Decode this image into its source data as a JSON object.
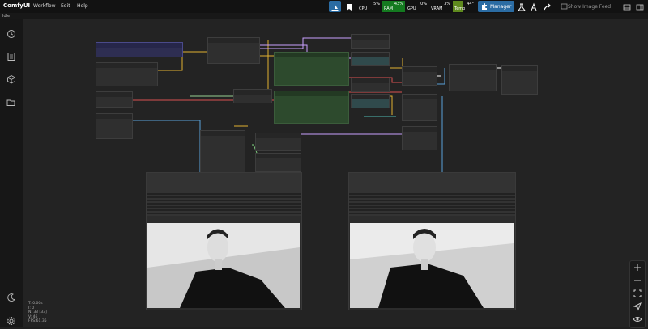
{
  "app": {
    "title": "ComfyUI"
  },
  "menu": [
    {
      "label": "Workflow"
    },
    {
      "label": "Edit"
    },
    {
      "label": "Help"
    }
  ],
  "status": {
    "queue": "Idle"
  },
  "monitors": {
    "cpu": {
      "label": "CPU",
      "value": "5%"
    },
    "ram": {
      "label": "RAM",
      "value": "43%"
    },
    "gpu": {
      "label": "GPU",
      "value": "0%"
    },
    "vram": {
      "label": "VRAM",
      "value": "3%"
    },
    "temp": {
      "label": "Temp",
      "value": "44°"
    }
  },
  "toolbar": {
    "manager_label": "Manager",
    "feed_label": "Show Image Feed"
  },
  "stats": {
    "t": "T: 0.00s",
    "i": "I: 0",
    "n": "N: 33 [33]",
    "v": "V: 46",
    "fps": "FPS:61.35"
  },
  "colors": {
    "accent": "#2b6ca3",
    "node_green": "#2d4a2d",
    "link_yellow": "#e0b030",
    "link_blue": "#5aa0d8",
    "link_red": "#d85050"
  }
}
